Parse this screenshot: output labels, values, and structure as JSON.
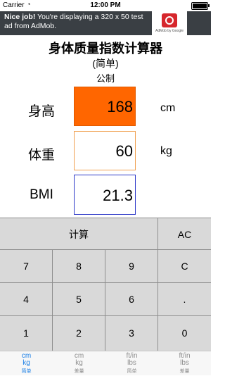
{
  "status_bar": {
    "carrier": "Carrier",
    "wifi_icon": "wifi-icon",
    "time": "12:00 PM",
    "battery_icon": "battery-icon"
  },
  "ad": {
    "headline": "Nice job!",
    "body": "You're displaying a 320 x 50 test ad from AdMob.",
    "logo_text": "AdMob by Google"
  },
  "header": {
    "title": "身体质量指数计算器",
    "subtitle": "(简单)",
    "unit_system": "公制"
  },
  "rows": [
    {
      "label": "身高",
      "value": "168",
      "unit": "cm",
      "color": "#ff6600"
    },
    {
      "label": "体重",
      "value": "60",
      "unit": "kg",
      "color": "#ffffff"
    },
    {
      "label": "BMI",
      "value": "21.3",
      "unit": "",
      "color": "#ffffff"
    }
  ],
  "keypad": {
    "calc": "计算",
    "ac": "AC",
    "keys": [
      "7",
      "8",
      "9",
      "C",
      "4",
      "5",
      "6",
      ".",
      "1",
      "2",
      "3",
      "0"
    ]
  },
  "tabs": [
    {
      "u1": "cm",
      "u2": "kg",
      "label": "简单",
      "active": true
    },
    {
      "u1": "cm",
      "u2": "kg",
      "label": "差量",
      "active": false
    },
    {
      "u1": "ft/in",
      "u2": "lbs",
      "label": "简单",
      "active": false
    },
    {
      "u1": "ft/in",
      "u2": "lbs",
      "label": "差量",
      "active": false
    }
  ],
  "colors": {
    "accent": "#1a7fe6",
    "height_field": "#ff6600",
    "bmi_border": "#2c38c8",
    "weight_border": "#f0a050"
  }
}
